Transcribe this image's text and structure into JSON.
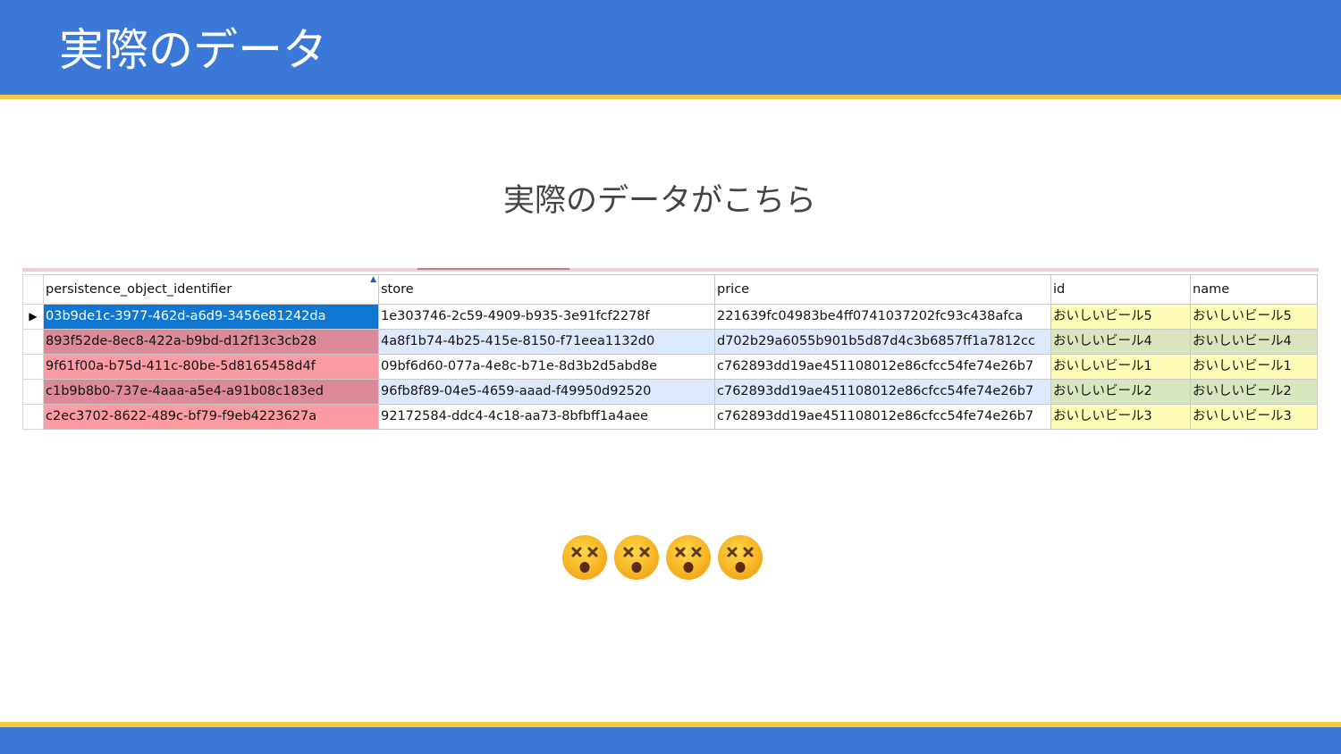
{
  "slide": {
    "title": "実際のデータ",
    "subtitle": "実際のデータがこちら",
    "theme_colors": {
      "header": "#3c78d8",
      "accent_stripe": "#f5c842"
    }
  },
  "grid": {
    "columns": [
      "persistence_object_identifier",
      "store",
      "price",
      "id",
      "name"
    ],
    "sorted_column": "persistence_object_identifier",
    "current_row_indicator": "▶",
    "rows": [
      [
        "03b9de1c-3977-462d-a6d9-3456e81242da",
        "1e303746-2c59-4909-b935-3e91fcf2278f",
        "221639fc04983be4ff0741037202fc93c438afca",
        "おいしいビール5",
        "おいしいビール5"
      ],
      [
        "893f52de-8ec8-422a-b9bd-d12f13c3cb28",
        "4a8f1b74-4b25-415e-8150-f71eea1132d0",
        "d702b29a6055b901b5d87d4c3b6857ff1a7812cc",
        "おいしいビール4",
        "おいしいビール4"
      ],
      [
        "9f61f00a-b75d-411c-80be-5d8165458d4f",
        "09bf6d60-077a-4e8c-b71e-8d3b2d5abd8e",
        "c762893dd19ae451108012e86cfcc54fe74e26b7",
        "おいしいビール1",
        "おいしいビール1"
      ],
      [
        "c1b9b8b0-737e-4aaa-a5e4-a91b08c183ed",
        "96fb8f89-04e5-4659-aaad-f49950d92520",
        "c762893dd19ae451108012e86cfcc54fe74e26b7",
        "おいしいビール2",
        "おいしいビール2"
      ],
      [
        "c2ec3702-8622-489c-bf79-f9eb4223627a",
        "92172584-ddc4-4c18-aa73-8bfbff1a4aee",
        "c762893dd19ae451108012e86cfcc54fe74e26b7",
        "おいしいビール3",
        "おいしいビール3"
      ]
    ],
    "highlight_colors": {
      "selected_cell": "#0f77d1",
      "pink_dark": "#dc8a9a",
      "pink": "#fd9ba2",
      "light_blue": "#dce8fb",
      "yellow": "#fefdb8",
      "green": "#d8e6bf"
    }
  },
  "emoji": {
    "name": "dizzy-face-icon",
    "count": 4
  }
}
